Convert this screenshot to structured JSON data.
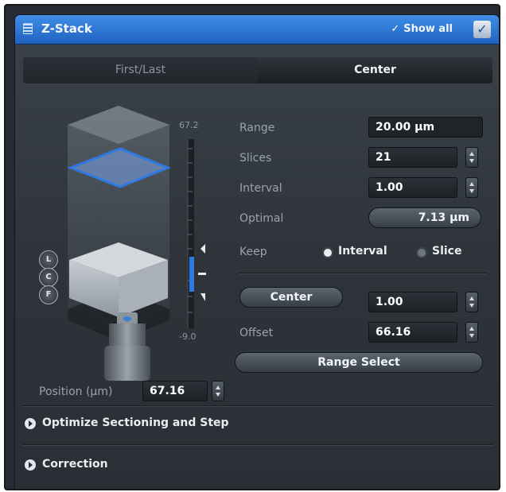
{
  "title": "Z-Stack",
  "show_all": "Show all",
  "tabs": [
    {
      "label": "First/Last",
      "active": false
    },
    {
      "label": "Center",
      "active": true
    }
  ],
  "scale": {
    "top": "67.2",
    "bottom": "-9.0"
  },
  "markers": [
    "L",
    "C",
    "F"
  ],
  "fields": {
    "range": {
      "label": "Range",
      "value": "20.00 µm"
    },
    "slices": {
      "label": "Slices",
      "value": "21"
    },
    "interval": {
      "label": "Interval",
      "value": "1.00"
    },
    "optimal": {
      "label": "Optimal",
      "button": "7.13 µm"
    },
    "keep": {
      "label": "Keep",
      "options": [
        "Interval",
        "Slice"
      ],
      "selected": "Interval"
    },
    "center": {
      "button": "Center",
      "value": "1.00"
    },
    "offset": {
      "label": "Offset",
      "value": "66.16"
    },
    "range_select": "Range Select",
    "position": {
      "label": "Position (µm)",
      "value": "67.16"
    }
  },
  "sections": [
    {
      "label": "Optimize Sectioning and Step"
    },
    {
      "label": "Correction"
    }
  ],
  "colors": {
    "accent": "#2f7ae0",
    "panel": "#2e343a",
    "highlight_plane": "#4a86e8"
  }
}
